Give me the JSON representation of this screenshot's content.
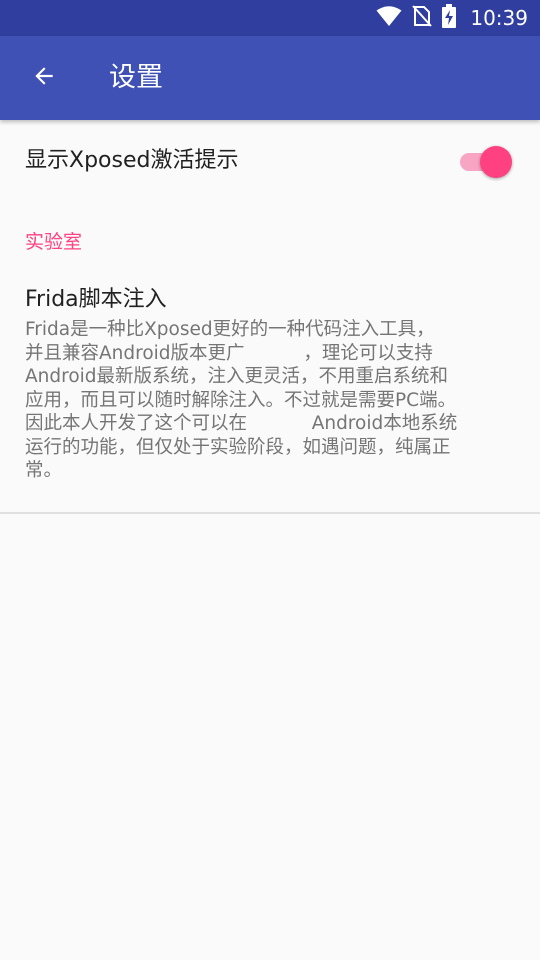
{
  "status_bar": {
    "time": "10:39",
    "icons": [
      "wifi-icon",
      "no-sim-icon",
      "battery-charging-icon"
    ]
  },
  "app_bar": {
    "back_icon": "arrow-back-icon",
    "title": "设置"
  },
  "preferences": {
    "xposed_hint": {
      "title": "显示Xposed激活提示",
      "enabled": true
    },
    "category": {
      "title": "实验室"
    },
    "frida": {
      "title": "Frida脚本注入",
      "summary_lines": [
        "Frida是一种比Xposed更好的一种代码注入工具，",
        "并且兼容Android版本更广          ，理论可以支持",
        "Android最新版系统，注入更灵活，不用重启系统和",
        "应用，而且可以随时解除注入。不过就是需要PC端。",
        "因此本人开发了这个可以在           Android本地系统",
        "运行的功能，但仅处于实验阶段，如遇问题，纯属正",
        "常。"
      ]
    }
  },
  "colors": {
    "status_bar": "#303F9F",
    "app_bar": "#3F51B5",
    "accent": "#FF4081",
    "background": "#FAFAFA"
  }
}
